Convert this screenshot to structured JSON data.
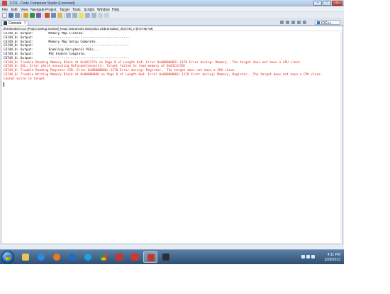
{
  "window": {
    "title": "CCS - Code Composer Studio (Licensed)",
    "minimize": "–",
    "maximize": "□",
    "close": "x"
  },
  "menu": [
    "File",
    "Edit",
    "View",
    "Navigate",
    "Project",
    "Target",
    "Tools",
    "Scripts",
    "Window",
    "Help"
  ],
  "tabs": {
    "console_label": "Console",
    "console_close": "x",
    "perspective_label": "C/C++"
  },
  "console": {
    "header": "cfeinstruited4 Ccs [Project Debug Session] Texas Instruments XDS100v2 USB Emulator_0/C674X_0 (9:57:55 AM)",
    "lines": [
      {
        "type": "out",
        "text": "C674X_0: Output:        Memory Map Cleared."
      },
      {
        "type": "out",
        "text": "C674X_0: Output:        -------------------------------------------"
      },
      {
        "type": "out",
        "text": "C674X_0: Output:        Memory Map Setup Complete."
      },
      {
        "type": "out",
        "text": "C674X_0: Output:        -------------------------------------------"
      },
      {
        "type": "out",
        "text": "C674X_0: Output:        Enabling Peripheral PSCs..."
      },
      {
        "type": "out",
        "text": "C674X_0: Output:        PSC Enable Complete."
      },
      {
        "type": "out",
        "text": "C674X_0: Output:        -------------------------------------------"
      },
      {
        "type": "err",
        "text": "C674X_0: Trouble Reading Memory Block at 0x10117fe on Page 0 of Length 0x4: Error 0x80000002/-1178 Error during: Memory,  The target does not have a CPU clock."
      },
      {
        "type": "err",
        "text": "C674X_0: GEL: Error while executing OnTargetConnect(): Target failed to read memory at 0x01C4170C"
      },
      {
        "type": "err",
        "text": "C674X_0: Trouble Reading Register CSR: Error 0x80000008/-1178 Error during: Register,  The target does not have a CPU clock."
      },
      {
        "type": "err",
        "text": "C674X_0: Trouble Writing Memory Block at 0x00000000 on Page 0 of Length 0x4: Error 0x80000008/-1178 Error during: Memory, Register,  The target does not have a CPU clock."
      },
      {
        "type": "err",
        "text": "Cannot write to target"
      }
    ]
  },
  "taskbar": {
    "apps": [
      "start",
      "explorer",
      "internet-explorer",
      "firefox",
      "media-player",
      "skype",
      "chrome",
      "code-composer",
      "acrobat",
      "ccs-task",
      "terminal"
    ],
    "clock_time": "4:11 PM",
    "clock_date": "2/28/2013"
  }
}
